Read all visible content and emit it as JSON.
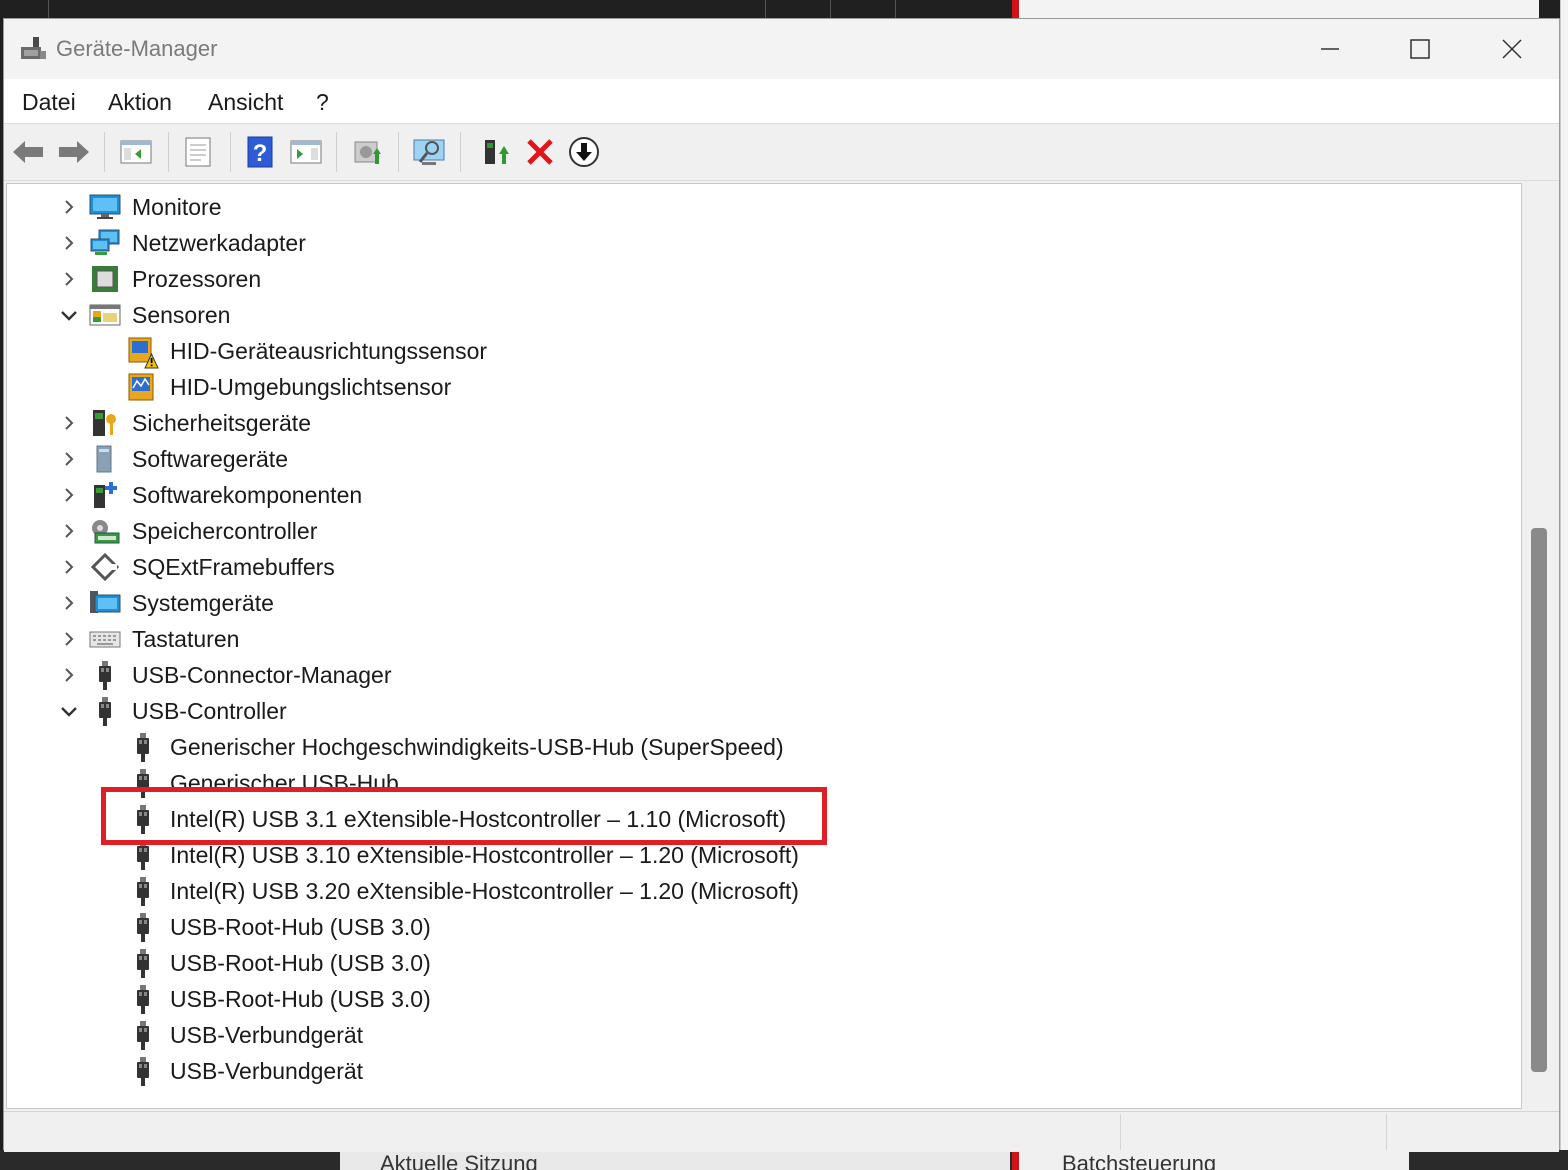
{
  "window": {
    "title": "Geräte-Manager"
  },
  "menu": [
    "Datei",
    "Aktion",
    "Ansicht",
    "?"
  ],
  "toolbar": [
    "back-arrow-icon",
    "forward-arrow-icon",
    "show-hide-console-tree-icon",
    "properties-icon",
    "help-icon",
    "action-pane-icon",
    "update-driver-icon",
    "scan-hardware-changes-icon",
    "enable-device-icon",
    "uninstall-device-icon",
    "disable-device-icon"
  ],
  "tree": [
    {
      "label": "Monitore",
      "level": 0,
      "expander": "collapsed",
      "icon": "monitor-icon"
    },
    {
      "label": "Netzwerkadapter",
      "level": 0,
      "expander": "collapsed",
      "icon": "network-adapter-icon"
    },
    {
      "label": "Prozessoren",
      "level": 0,
      "expander": "collapsed",
      "icon": "processor-icon"
    },
    {
      "label": "Sensoren",
      "level": 0,
      "expander": "expanded",
      "icon": "sensor-icon"
    },
    {
      "label": "HID-Geräteausrichtungssensor",
      "level": 1,
      "expander": "none",
      "icon": "sensor-warning-icon"
    },
    {
      "label": "HID-Umgebungslichtsensor",
      "level": 1,
      "expander": "none",
      "icon": "sensor-device-icon"
    },
    {
      "label": "Sicherheitsgeräte",
      "level": 0,
      "expander": "collapsed",
      "icon": "security-device-icon"
    },
    {
      "label": "Softwaregeräte",
      "level": 0,
      "expander": "collapsed",
      "icon": "software-device-icon"
    },
    {
      "label": "Softwarekomponenten",
      "level": 0,
      "expander": "collapsed",
      "icon": "software-component-icon"
    },
    {
      "label": "Speichercontroller",
      "level": 0,
      "expander": "collapsed",
      "icon": "storage-controller-icon"
    },
    {
      "label": "SQExtFramebuffers",
      "level": 0,
      "expander": "collapsed",
      "icon": "framebuffer-icon"
    },
    {
      "label": "Systemgeräte",
      "level": 0,
      "expander": "collapsed",
      "icon": "system-device-icon"
    },
    {
      "label": "Tastaturen",
      "level": 0,
      "expander": "collapsed",
      "icon": "keyboard-icon"
    },
    {
      "label": "USB-Connector-Manager",
      "level": 0,
      "expander": "collapsed",
      "icon": "usb-plug-icon"
    },
    {
      "label": "USB-Controller",
      "level": 0,
      "expander": "expanded",
      "icon": "usb-plug-icon"
    },
    {
      "label": "Generischer Hochgeschwindigkeits-USB-Hub (SuperSpeed)",
      "level": 1,
      "expander": "none",
      "icon": "usb-plug-icon"
    },
    {
      "label": "Generischer USB-Hub",
      "level": 1,
      "expander": "none",
      "icon": "usb-plug-icon"
    },
    {
      "label": "Intel(R) USB 3.1 eXtensible-Hostcontroller – 1.10 (Microsoft)",
      "level": 1,
      "expander": "none",
      "icon": "usb-plug-icon",
      "highlighted": true
    },
    {
      "label": "Intel(R) USB 3.10 eXtensible-Hostcontroller – 1.20 (Microsoft)",
      "level": 1,
      "expander": "none",
      "icon": "usb-plug-icon"
    },
    {
      "label": "Intel(R) USB 3.20 eXtensible-Hostcontroller – 1.20 (Microsoft)",
      "level": 1,
      "expander": "none",
      "icon": "usb-plug-icon"
    },
    {
      "label": "USB-Root-Hub (USB 3.0)",
      "level": 1,
      "expander": "none",
      "icon": "usb-plug-icon"
    },
    {
      "label": "USB-Root-Hub (USB 3.0)",
      "level": 1,
      "expander": "none",
      "icon": "usb-plug-icon"
    },
    {
      "label": "USB-Root-Hub (USB 3.0)",
      "level": 1,
      "expander": "none",
      "icon": "usb-plug-icon"
    },
    {
      "label": "USB-Verbundgerät",
      "level": 1,
      "expander": "none",
      "icon": "usb-plug-icon"
    },
    {
      "label": "USB-Verbundgerät",
      "level": 1,
      "expander": "none",
      "icon": "usb-plug-icon"
    }
  ],
  "background": {
    "bottom_left_text": "Aktuelle Sitzung",
    "bottom_right_text": "Batchsteuerung"
  },
  "colors": {
    "highlight": "#e01e25",
    "background_accent": "#d0151a"
  }
}
